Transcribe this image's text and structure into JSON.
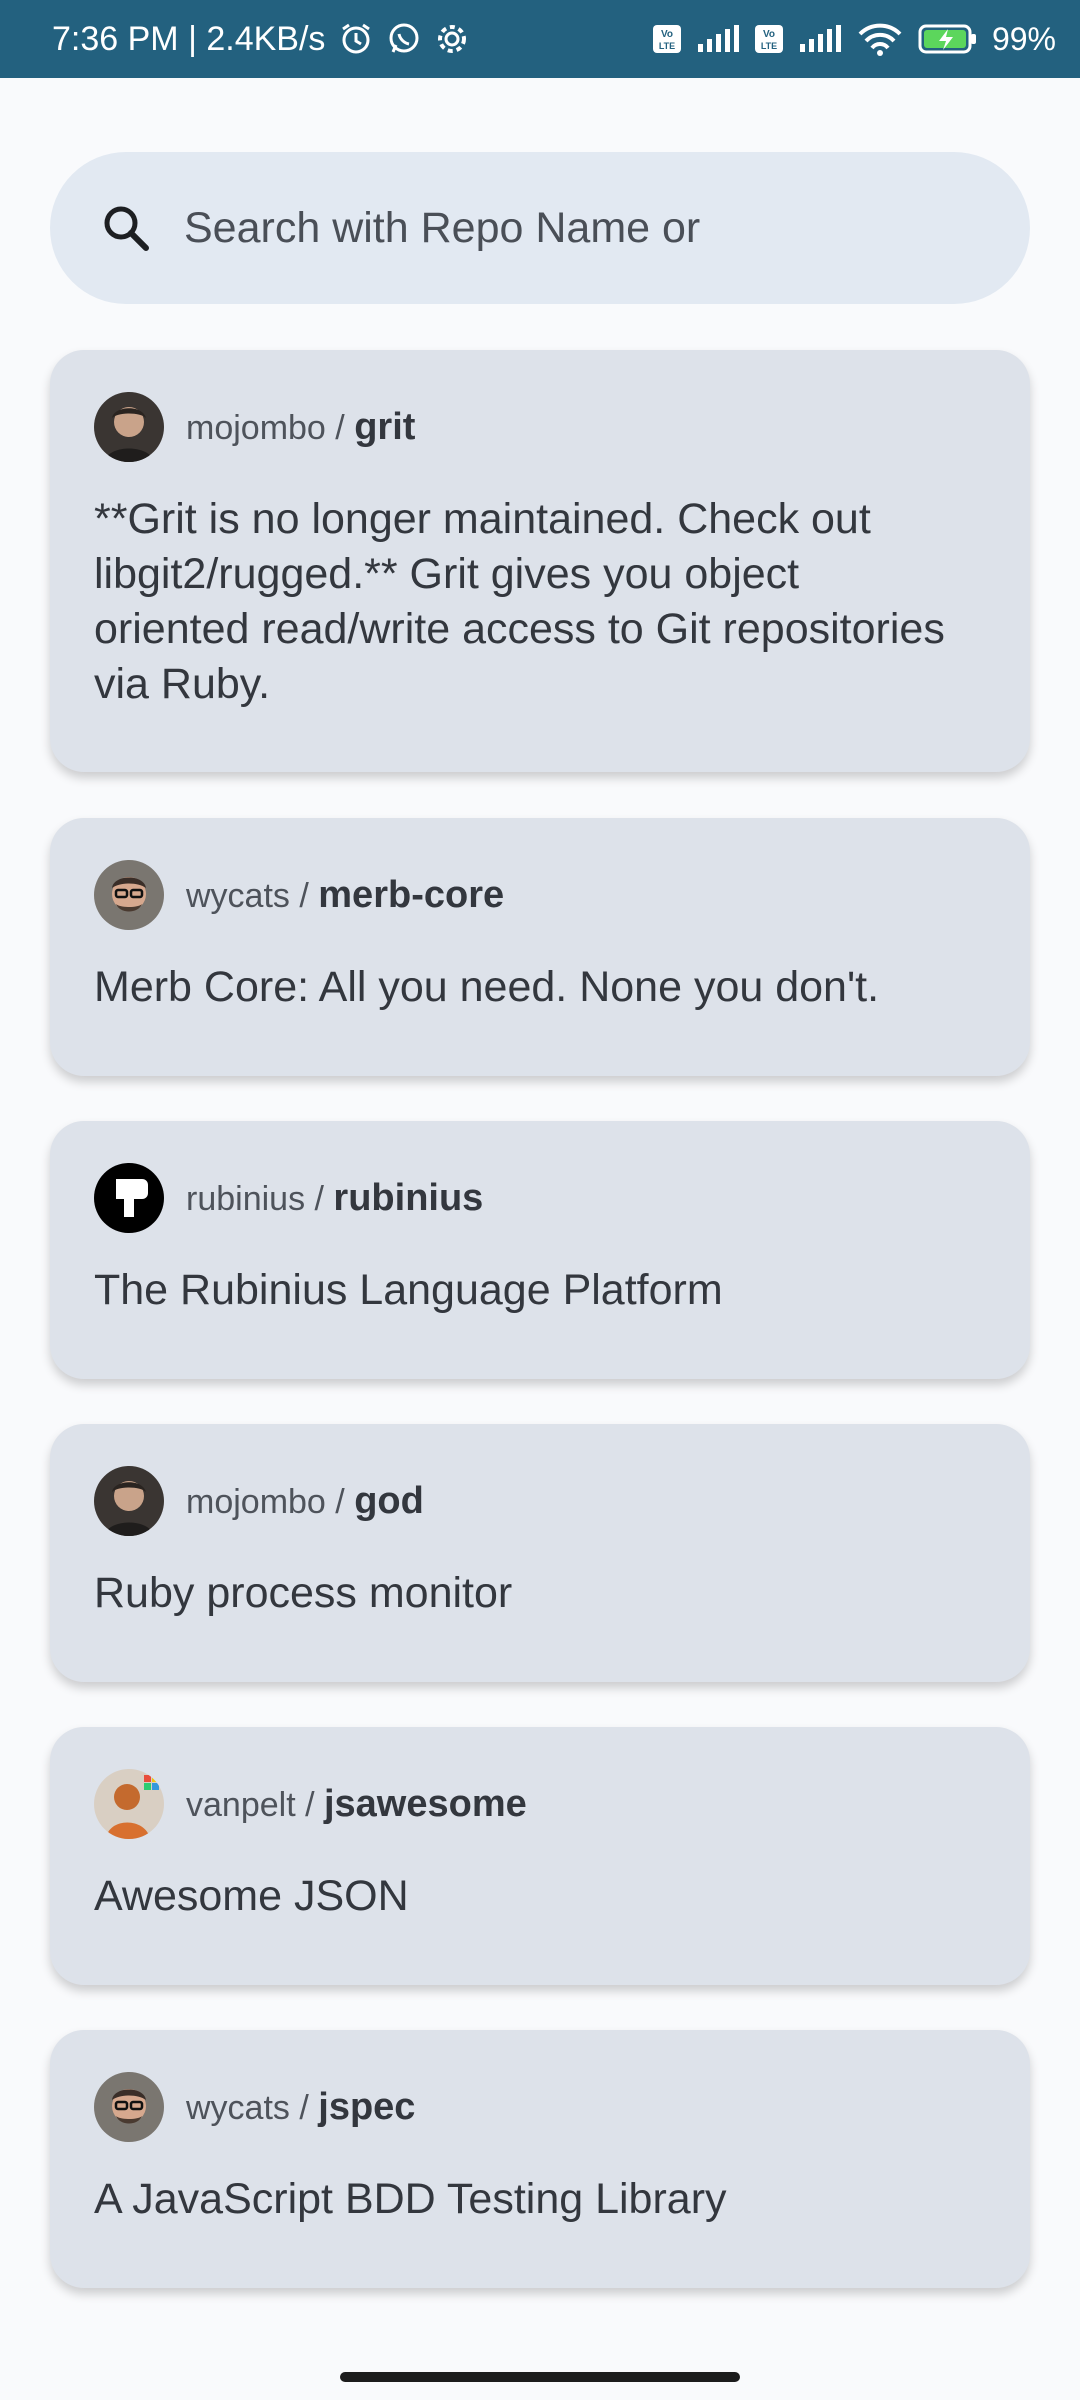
{
  "status_bar": {
    "time_speed": "7:36 PM | 2.4KB/s",
    "battery": "99%",
    "left_icons": [
      "alarm-icon",
      "whatsapp-icon",
      "settings-icon"
    ],
    "right_icons": [
      "volte-icon",
      "signal-icon",
      "volte-icon",
      "signal-icon",
      "wifi-icon",
      "battery-charging-icon"
    ]
  },
  "search": {
    "placeholder": "Search with Repo Name or",
    "value": ""
  },
  "repos": [
    {
      "owner": "mojombo",
      "separator": " / ",
      "name": "grit",
      "description": "**Grit is no longer maintained. Check out libgit2/rugged.** Grit gives you object oriented read/write access to Git repositories via Ruby."
    },
    {
      "owner": "wycats",
      "separator": " / ",
      "name": "merb-core",
      "description": "Merb Core: All you need. None you don't."
    },
    {
      "owner": "rubinius",
      "separator": " / ",
      "name": "rubinius",
      "description": "The Rubinius Language Platform"
    },
    {
      "owner": "mojombo",
      "separator": " / ",
      "name": "god",
      "description": "Ruby process monitor"
    },
    {
      "owner": "vanpelt",
      "separator": " / ",
      "name": "jsawesome",
      "description": "Awesome JSON"
    },
    {
      "owner": "wycats",
      "separator": " / ",
      "name": "jspec",
      "description": "A JavaScript BDD Testing Library"
    }
  ],
  "colors": {
    "status_bar": "#23617f",
    "background": "#f9fafc",
    "search_bg": "#e2e9f2",
    "card_bg": "#dde2ea",
    "text": "#33373e"
  }
}
